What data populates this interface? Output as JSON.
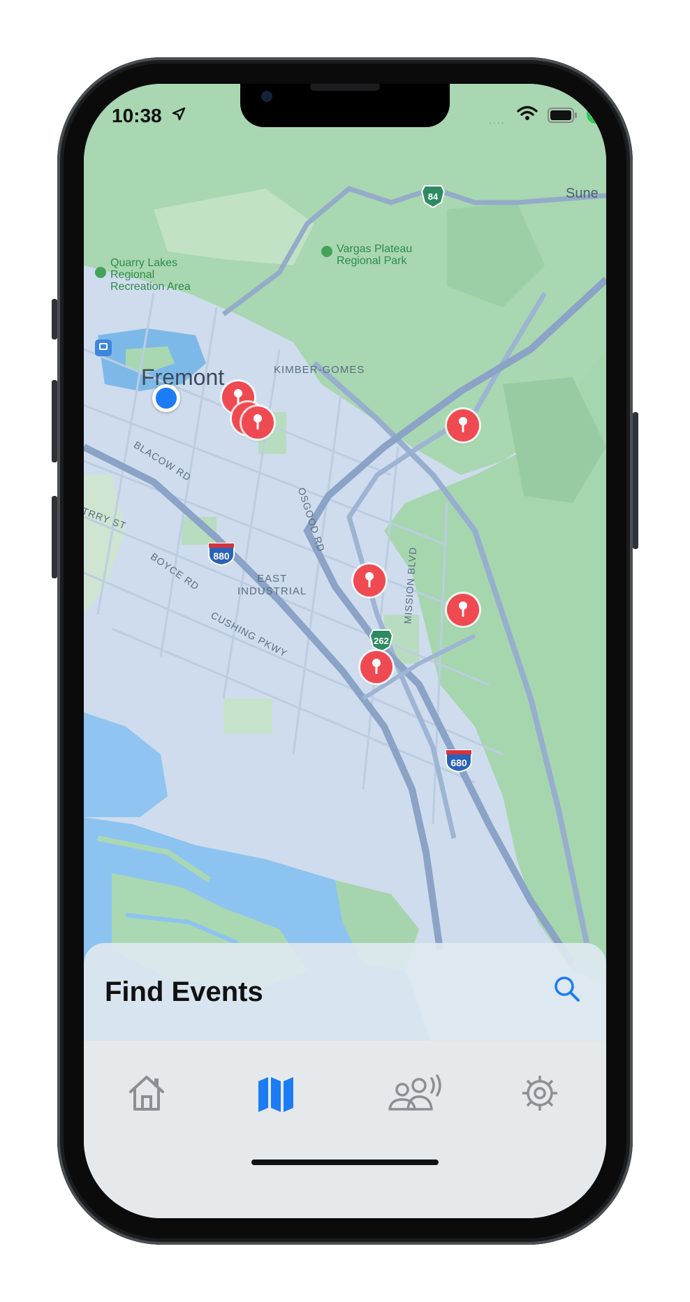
{
  "status_bar": {
    "time": "10:38",
    "cellular_dots": "....",
    "battery_icon": "battery-full-icon"
  },
  "map": {
    "places": {
      "city": "Fremont",
      "quarry": [
        "Quarry Lakes",
        "Regional",
        "Recreation Area"
      ],
      "vargas": [
        "Vargas Plateau",
        "Regional Park"
      ],
      "kimber": "KIMBER-GOMES",
      "east_industrial": [
        "EAST",
        "INDUSTRIAL"
      ],
      "sunol": "Sune"
    },
    "roads": {
      "blacow": "BLACOW RD",
      "osgood": "OSGOOD RD",
      "mission": "MISSION BLVD",
      "boyce": "BOYCE RD",
      "cushing": "CUSHING PKWY",
      "stevenson": "TRRY ST"
    },
    "shields": {
      "i880": "880",
      "sr262": "262",
      "sr84": "84",
      "i680": "680"
    },
    "event_pin_count": 8
  },
  "sheet": {
    "title": "Find Events",
    "search_icon": "magnifying-glass-icon"
  },
  "tabs": [
    {
      "name": "Home",
      "icon": "house-icon",
      "selected": false
    },
    {
      "name": "Map",
      "icon": "map-icon",
      "selected": true
    },
    {
      "name": "Community",
      "icon": "people-broadcast-icon",
      "selected": false
    },
    {
      "name": "Settings",
      "icon": "gear-icon",
      "selected": false
    }
  ],
  "colors": {
    "accent": "#1b7cf5",
    "pin": "#ef4a52",
    "park": "#9fd3a8",
    "water": "#8fc2ef",
    "road": "#8aa7c9"
  }
}
